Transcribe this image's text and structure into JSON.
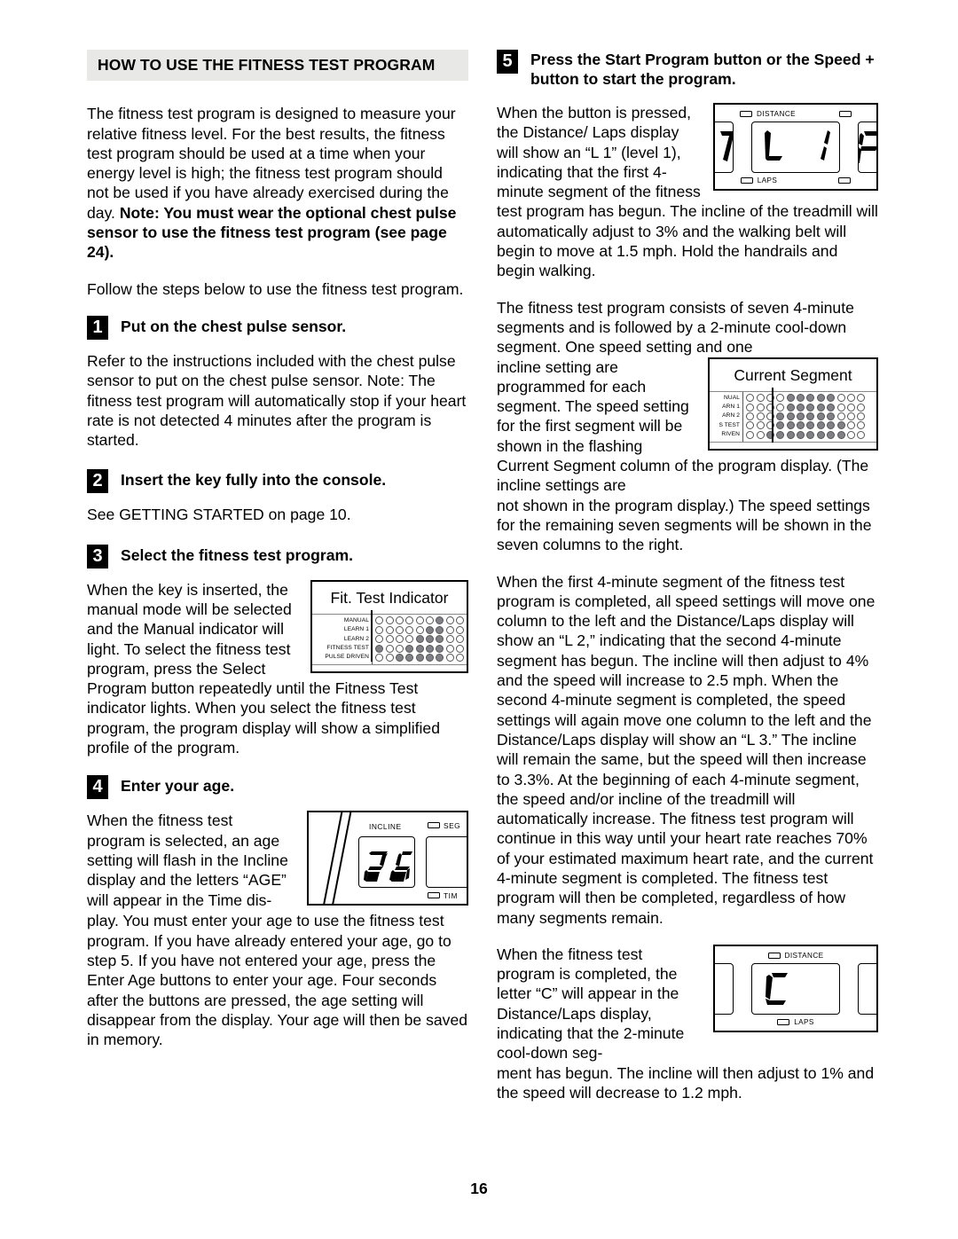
{
  "document": {
    "page_number": "16"
  },
  "left_column": {
    "section_heading": "HOW TO USE THE FITNESS TEST PROGRAM",
    "intro_paragraph_normal": "The fitness test program is designed to measure your relative fitness level. For the best results, the fitness test program should be used at a time when your energy level is high; the fitness test program should not be used if you have already exercised during the day. ",
    "intro_paragraph_bold": "Note: You must wear the optional chest pulse sensor to use the fitness test program (see page 24).",
    "follow_steps": "Follow the steps below to use the fitness test program.",
    "steps": [
      {
        "number": "1",
        "title": "Put on the chest pulse sensor.",
        "body": "Refer to the instructions included with the chest pulse sensor to put on the chest pulse sensor. Note: The fitness test program will automatically stop if your heart rate is not detected 4 minutes after the program is started."
      },
      {
        "number": "2",
        "title": "Insert the key fully into the console.",
        "body": "See GETTING STARTED on page 10."
      },
      {
        "number": "3",
        "title": "Select the fitness test program.",
        "body_wrap": "When the key is inserted, the manual mode will be selected and the Manual indicator will light. To select the fitness test program, press the Select",
        "body_rest": "Program button repeatedly until the Fitness Test indicator lights. When you select the fitness test program, the program display will show a simplified profile of the program."
      },
      {
        "number": "4",
        "title": "Enter your age.",
        "body_wrap": "When the fitness test program is selected, an age setting will flash in the Incline display and the letters “AGE” will appear in the Time dis-",
        "body_rest": "play. You must enter your age to use the fitness test program. If you have already entered your age, go to step 5. If you have not entered your age, press the Enter Age buttons to enter your age. Four seconds after the buttons are pressed, the age setting will disappear from the display. Your age will then be saved in memory."
      }
    ],
    "fit_test_figure": {
      "caption": "Fit. Test Indicator",
      "row_labels": [
        "MANUAL",
        "LEARN 1",
        "LEARN 2",
        "FITNESS TEST",
        "PULSE DRIVEN"
      ],
      "matrix": [
        [
          0,
          0,
          0,
          0,
          0,
          0,
          1,
          0,
          0
        ],
        [
          0,
          0,
          0,
          0,
          0,
          1,
          1,
          0,
          0
        ],
        [
          0,
          0,
          0,
          0,
          1,
          1,
          1,
          0,
          0
        ],
        [
          1,
          0,
          0,
          1,
          1,
          1,
          1,
          0,
          0
        ],
        [
          0,
          0,
          1,
          1,
          1,
          1,
          1,
          0,
          0
        ]
      ]
    },
    "incline_figure": {
      "incline_label": "INCLINE",
      "value": "26",
      "seg_label": "SEG",
      "time_label": "TIM"
    }
  },
  "right_column": {
    "steps": [
      {
        "number": "5",
        "title": "Press the Start Program button or the Speed + button to start the program."
      }
    ],
    "paragraph_1_wrap": "When the button is pressed, the Distance/ Laps display will show an “L 1” (level 1), indicating that the first 4-minute segment of the fitness",
    "paragraph_1_rest": "test program has begun. The incline of the treadmill will automatically adjust to 3% and the walking belt will begin to move at 1.5 mph. Hold the handrails and begin walking.",
    "paragraph_2_lead": "The fitness test program consists of seven 4-minute segments and is followed by a 2-minute cool-down segment. One speed setting and one",
    "paragraph_2_wrap": "incline setting are programmed for each segment. The speed setting for the first segment will be shown in the flashing Current Segment column of the program display. (The incline settings are",
    "paragraph_2_rest": "not shown in the program display.) The speed settings for the remaining seven segments will be shown in the seven columns to the right.",
    "paragraph_3": "When the first 4-minute segment of the fitness test program is completed, all speed settings will move one column to the left and the Distance/Laps display will show an “L 2,” indicating that the second 4-minute segment has begun. The incline will then adjust to 4% and the speed will increase to 2.5 mph. When the second 4-minute segment is completed, the speed settings will again move one column to the left and the Distance/Laps display will show an “L 3.” The incline will remain the same, but the speed will then increase to 3.3%. At the beginning of each 4-minute segment, the speed and/or incline of the treadmill will automatically increase. The fitness test program will continue in this way until your heart rate reaches 70% of your estimated maximum heart rate, and the current 4-minute segment is completed. The fitness test program will then be completed, regardless of how many segments remain.",
    "paragraph_4_wrap": "When the fitness test program is completed, the letter “C” will appear in the Distance/Laps display, indicating that the 2-minute cool-down seg-",
    "paragraph_4_rest": "ment has begun. The incline will then adjust to 1% and the speed will decrease to 1.2 mph.",
    "distance_laps_figure": {
      "distance_label": "DISTANCE",
      "laps_label": "LAPS",
      "left_partial_digit": "7",
      "center_value": "L 1",
      "right_partial_digit": "F"
    },
    "current_segment_figure": {
      "caption": "Current Segment",
      "row_labels": [
        "NUAL",
        "ARN 1",
        "ARN 2",
        "S TEST",
        "RIVEN"
      ],
      "matrix": [
        [
          0,
          0,
          0,
          0,
          1,
          1,
          1,
          1,
          1,
          0,
          0,
          0
        ],
        [
          0,
          0,
          0,
          0,
          1,
          1,
          1,
          1,
          1,
          0,
          0,
          0
        ],
        [
          0,
          0,
          0,
          1,
          1,
          1,
          1,
          1,
          1,
          0,
          0,
          0
        ],
        [
          0,
          0,
          0,
          1,
          1,
          1,
          1,
          1,
          1,
          1,
          0,
          0
        ],
        [
          0,
          0,
          1,
          1,
          1,
          1,
          1,
          1,
          1,
          1,
          0,
          0
        ]
      ]
    },
    "cooldown_figure": {
      "distance_label": "DISTANCE",
      "laps_label": "LAPS",
      "center_value": "C"
    }
  }
}
